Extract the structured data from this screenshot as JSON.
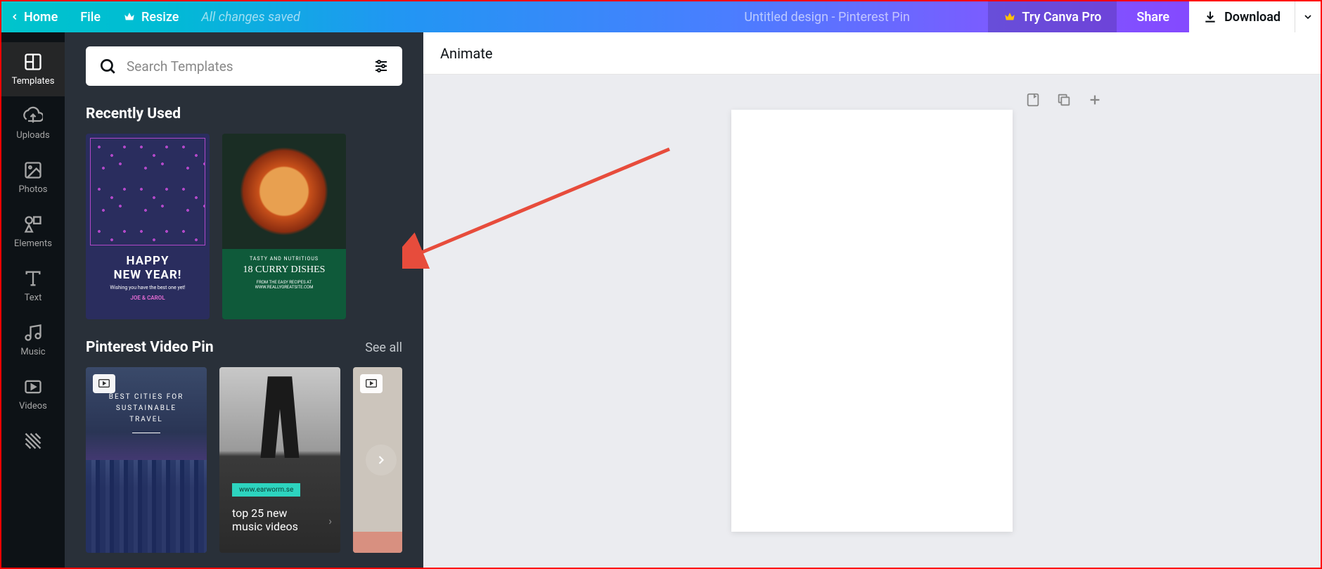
{
  "topbar": {
    "home": "Home",
    "file": "File",
    "resize": "Resize",
    "status": "All changes saved",
    "title": "Untitled design - Pinterest Pin",
    "try_pro": "Try Canva Pro",
    "share": "Share",
    "download": "Download"
  },
  "nav": {
    "templates": "Templates",
    "uploads": "Uploads",
    "photos": "Photos",
    "elements": "Elements",
    "text": "Text",
    "music": "Music",
    "videos": "Videos"
  },
  "search": {
    "placeholder": "Search Templates"
  },
  "sections": {
    "recently_used": "Recently Used",
    "pinterest_video": "Pinterest Video Pin",
    "see_all": "See all"
  },
  "templates": {
    "t1": {
      "line1": "HAPPY",
      "line2": "NEW YEAR!",
      "sub": "Wishing you have the best one yet!",
      "name": "JOE & CAROL"
    },
    "t2": {
      "tag": "TASTY AND NUTRITIOUS",
      "title": "18 CURRY DISHES",
      "sub1": "FROM THE EASY RECIPES AT",
      "sub2": "WWW.REALLYGREATSITE.COM"
    },
    "v1": {
      "l1": "BEST CITIES FOR",
      "l2": "SUSTAINABLE",
      "l3": "TRAVEL"
    },
    "v2": {
      "tag": "www.earworm.se",
      "l1": "top 25 new",
      "l2": "music videos"
    }
  },
  "toolbar": {
    "animate": "Animate"
  }
}
